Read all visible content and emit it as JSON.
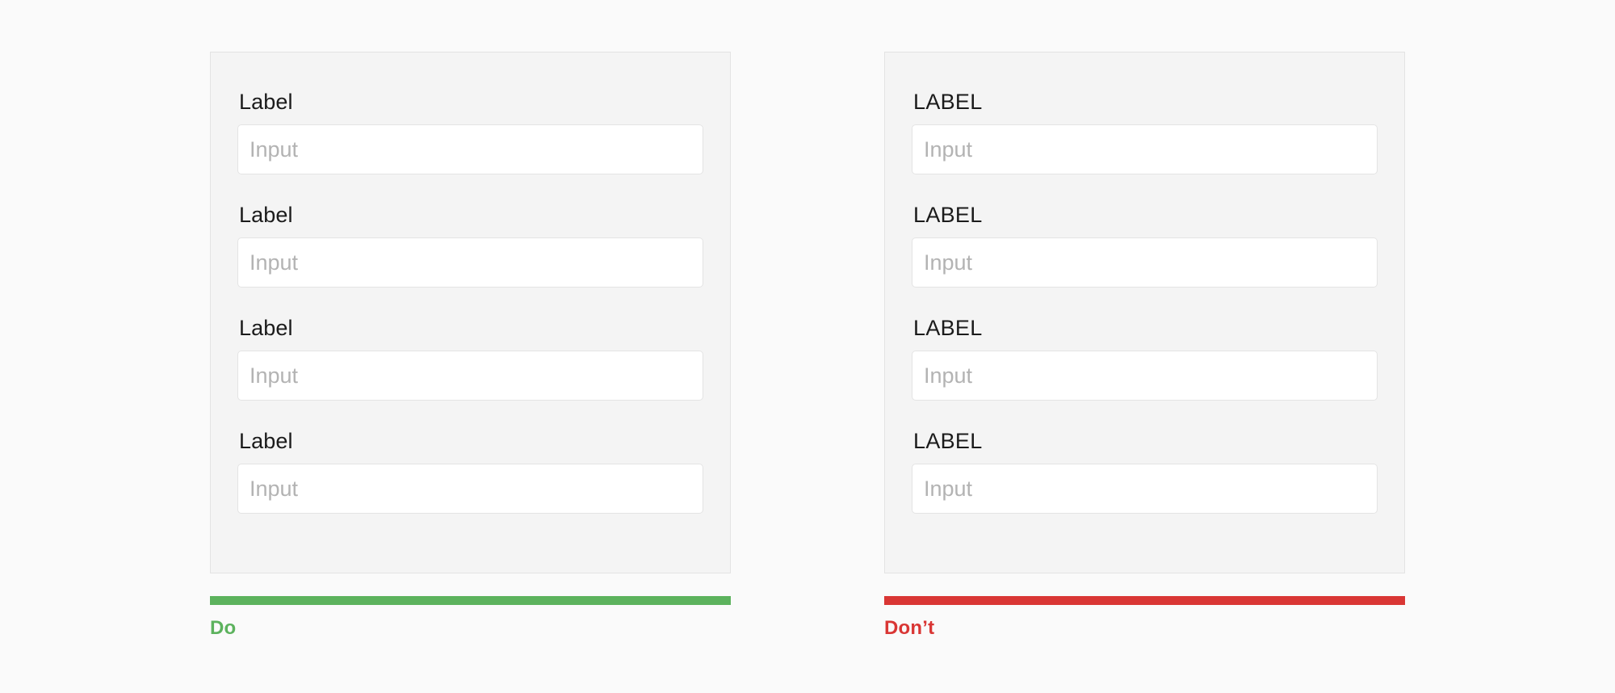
{
  "page": {
    "background_color": "#fafafa",
    "panel_background_color": "#f4f4f4",
    "panel_border_color": "#e3e3e3"
  },
  "examples": [
    {
      "id": "do",
      "verdict_label": "Do",
      "verdict_color": "#5cb25d",
      "fields": [
        {
          "label": "Label",
          "value": "",
          "placeholder": "Input"
        },
        {
          "label": "Label",
          "value": "",
          "placeholder": "Input"
        },
        {
          "label": "Label",
          "value": "",
          "placeholder": "Input"
        },
        {
          "label": "Label",
          "value": "",
          "placeholder": "Input"
        }
      ]
    },
    {
      "id": "dont",
      "verdict_label": "Don’t",
      "verdict_color": "#d93634",
      "fields": [
        {
          "label": "LABEL",
          "value": "",
          "placeholder": "Input"
        },
        {
          "label": "LABEL",
          "value": "",
          "placeholder": "Input"
        },
        {
          "label": "LABEL",
          "value": "",
          "placeholder": "Input"
        },
        {
          "label": "LABEL",
          "value": "",
          "placeholder": "Input"
        }
      ]
    }
  ]
}
